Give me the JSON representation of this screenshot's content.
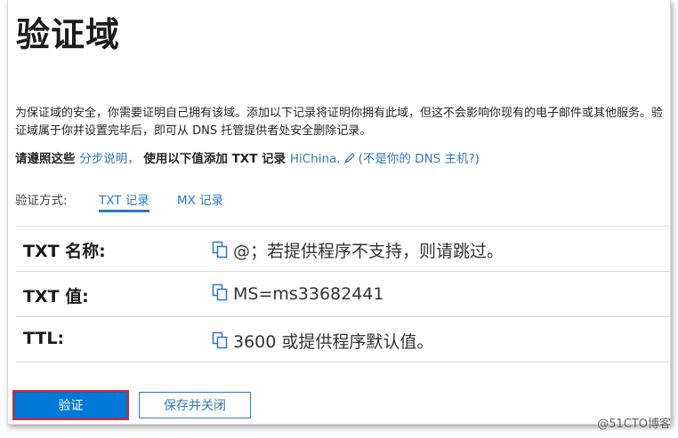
{
  "title": "验证域",
  "description": "为保证域的安全，你需要证明自己拥有该域。添加以下记录将证明你拥有此域，但这不会影响你现有的电子邮件或其他服务。验证域属于你并设置完毕后，即可从 DNS 托管提供者处安全删除记录。",
  "instructions": {
    "prefix": "请遵照这些 ",
    "steps_link": "分步说明，",
    "middle": " 使用以下值添加 TXT 记录 ",
    "host_link": "HiChina.",
    "not_host_link": "(不是你的 DNS 主机?)"
  },
  "verify_method": {
    "label": "验证方式:",
    "tabs": [
      {
        "label": "TXT 记录",
        "active": true
      },
      {
        "label": "MX 记录",
        "active": false
      }
    ]
  },
  "records": [
    {
      "label": "TXT 名称:",
      "value": "@；若提供程序不支持，则请跳过。"
    },
    {
      "label": "TXT 值:",
      "value": "MS=ms33682441"
    },
    {
      "label": "TTL:",
      "value": "3600 或提供程序默认值。"
    }
  ],
  "buttons": {
    "verify": "验证",
    "save_close": "保存并关闭"
  },
  "watermark": "@51CTO博客",
  "colors": {
    "accent": "#0078d7",
    "link": "#2f77c0",
    "highlight_border": "#e0262b"
  }
}
